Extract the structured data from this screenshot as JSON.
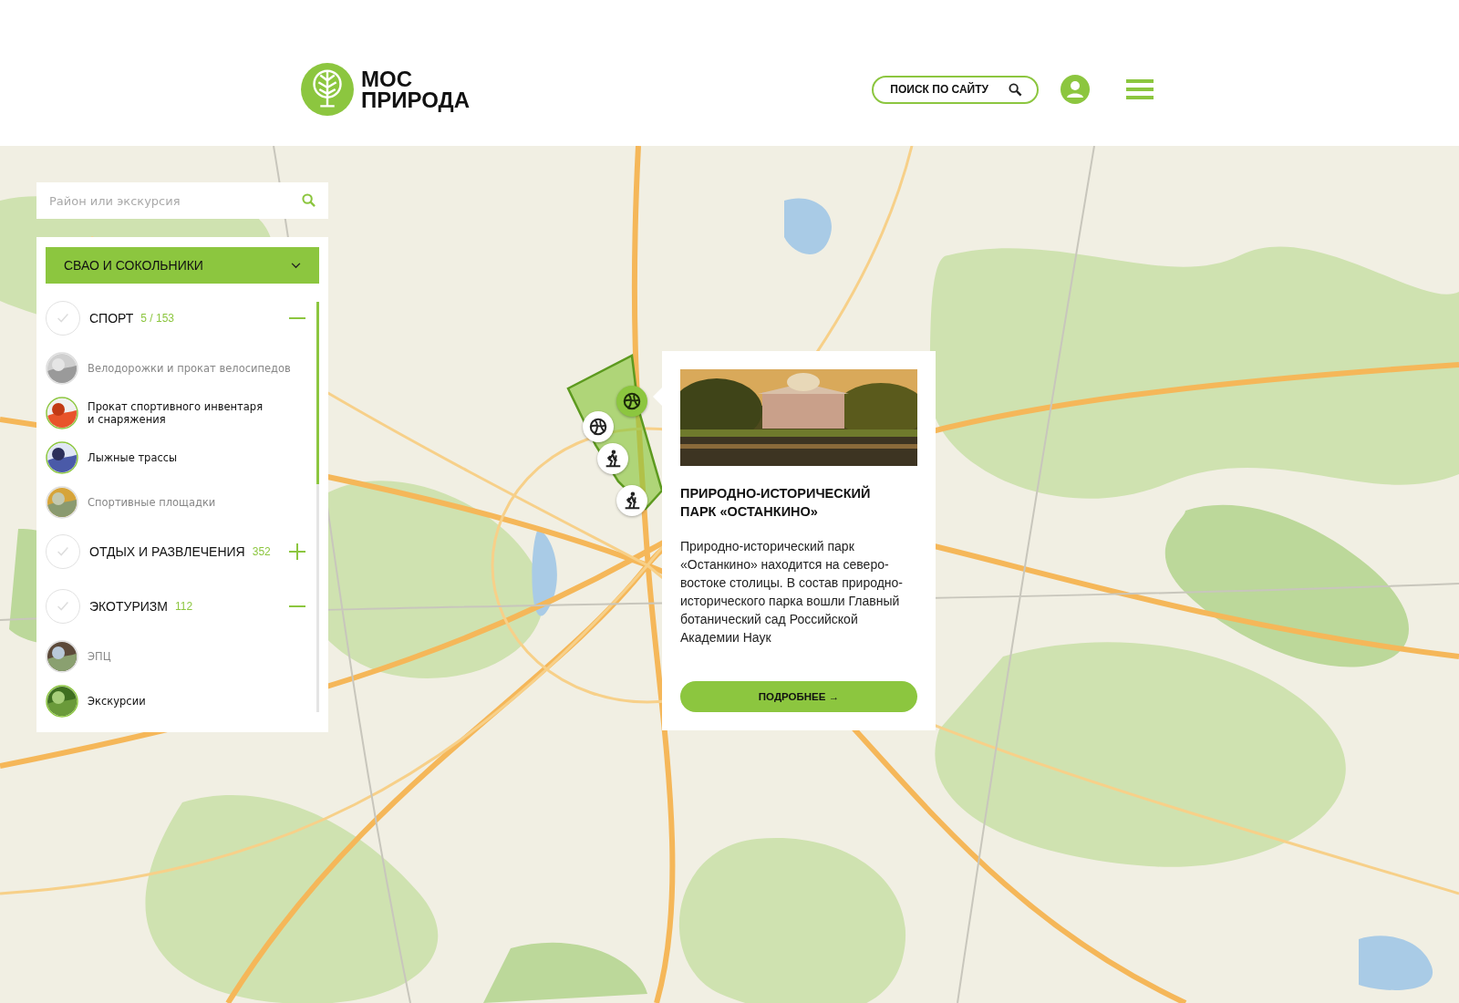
{
  "header": {
    "logo_line_1": "МОС",
    "logo_line_2": "ПРИРОДА",
    "search_button": "ПОИСК ПО САЙТУ"
  },
  "map": {
    "markers": [
      {
        "kind": "ball",
        "selected": true
      },
      {
        "kind": "ball",
        "selected": false
      },
      {
        "kind": "ski",
        "selected": false
      },
      {
        "kind": "ski",
        "selected": false
      }
    ]
  },
  "sidebar": {
    "search": {
      "placeholder": "Район или экскурсия"
    },
    "district": "СВАО И СОКОЛЬНИКИ",
    "categories": [
      {
        "title": "СПОРТ",
        "count": "5 / 153",
        "checked": false,
        "expanded": true,
        "items": [
          {
            "label": "Велодорожки и прокат велосипедов",
            "active": false
          },
          {
            "label": "Прокат спортивного инвентаря\nи снаряжения",
            "active": true
          },
          {
            "label": "Лыжные трассы",
            "active": true
          },
          {
            "label": "Спортивные площадки",
            "active": false
          }
        ]
      },
      {
        "title": "ОТДЫХ И РАЗВЛЕЧЕНИЯ",
        "count": "352",
        "checked": false,
        "expanded": false
      },
      {
        "title": "ЭКОТУРИЗМ",
        "count": "112",
        "checked": false,
        "expanded": true,
        "items": [
          {
            "label": "ЭПЦ",
            "active": false
          },
          {
            "label": "Экскурсии",
            "active": true
          }
        ]
      }
    ]
  },
  "popup": {
    "title": "ПРИРОДНО-ИСТОРИЧЕСКИЙ\nПАРК «ОСТАНКИНО»",
    "text": "Природно-исторический парк «Останкино» находится на северо-востоке столицы. В состав природно-исторического парка вошли Главный ботанический сад Российской Академии Наук",
    "button": "ПОДРОБНЕЕ →"
  }
}
